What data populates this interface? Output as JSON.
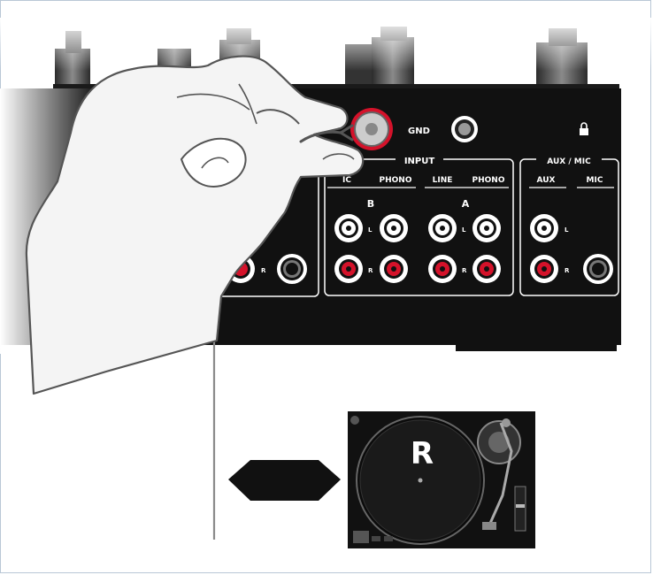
{
  "mixer": {
    "gnd_label": "GND",
    "lock_icon": "lock-icon",
    "input_group": {
      "title": "INPUT",
      "columns": [
        "IC",
        "PHONO",
        "LINE",
        "PHONO"
      ],
      "channel_b": "B",
      "channel_a": "A",
      "left_marker": "L",
      "right_marker": "R"
    },
    "aux_group": {
      "title": "AUX / MIC",
      "columns": [
        "AUX",
        "MIC"
      ],
      "left_marker": "L",
      "right_marker": "R"
    },
    "partial_marker": "R"
  },
  "turntable": {
    "platter_label": "R"
  },
  "colors": {
    "panel": "#111111",
    "jack_red": "#d4122a",
    "outline": "#ffffff"
  }
}
